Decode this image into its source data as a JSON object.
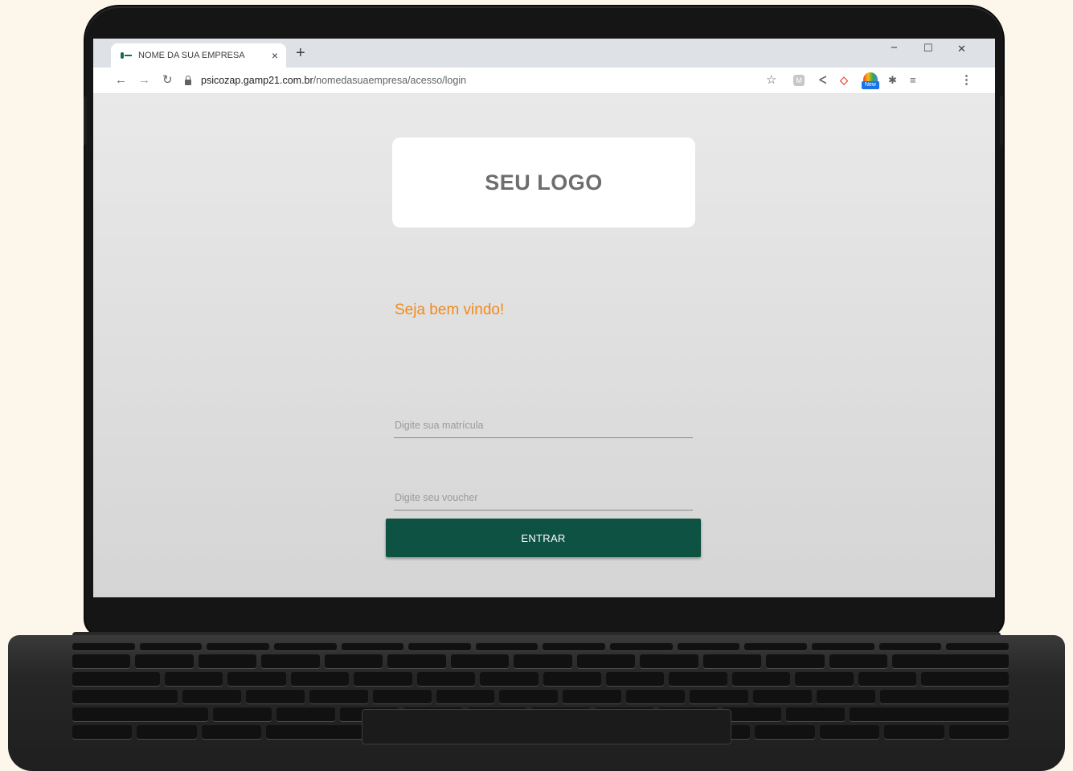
{
  "browser": {
    "tab_title": "NOME DA SUA EMPRESA",
    "tab_close": "×",
    "new_tab": "+",
    "url_host": "psicozap.gamp21.com.br",
    "url_path": "/nomedasuaempresa/acesso/login",
    "window_controls": {
      "minimize": "−",
      "maximize": "☐",
      "close": "✕"
    },
    "nav": {
      "back": "←",
      "forward": "→",
      "reload": "↻"
    },
    "toolbar_icons": {
      "bookmark": "☆",
      "ext_m": "M",
      "ext_k": "ᐸ",
      "ext_arrow": "◇",
      "ext_new_badge": "New",
      "extensions": "✱",
      "reading_list": "≡",
      "menu": "⋮"
    }
  },
  "login": {
    "logo_text": "SEU LOGO",
    "welcome": "Seja bem vindo!",
    "matricula_placeholder": "Digite sua matrícula",
    "voucher_placeholder": "Digite seu voucher",
    "submit_label": "ENTRAR"
  },
  "colors": {
    "accent_orange": "#f08a1d",
    "button_green": "#0e5244",
    "page_bg": "#e3e3e3"
  }
}
